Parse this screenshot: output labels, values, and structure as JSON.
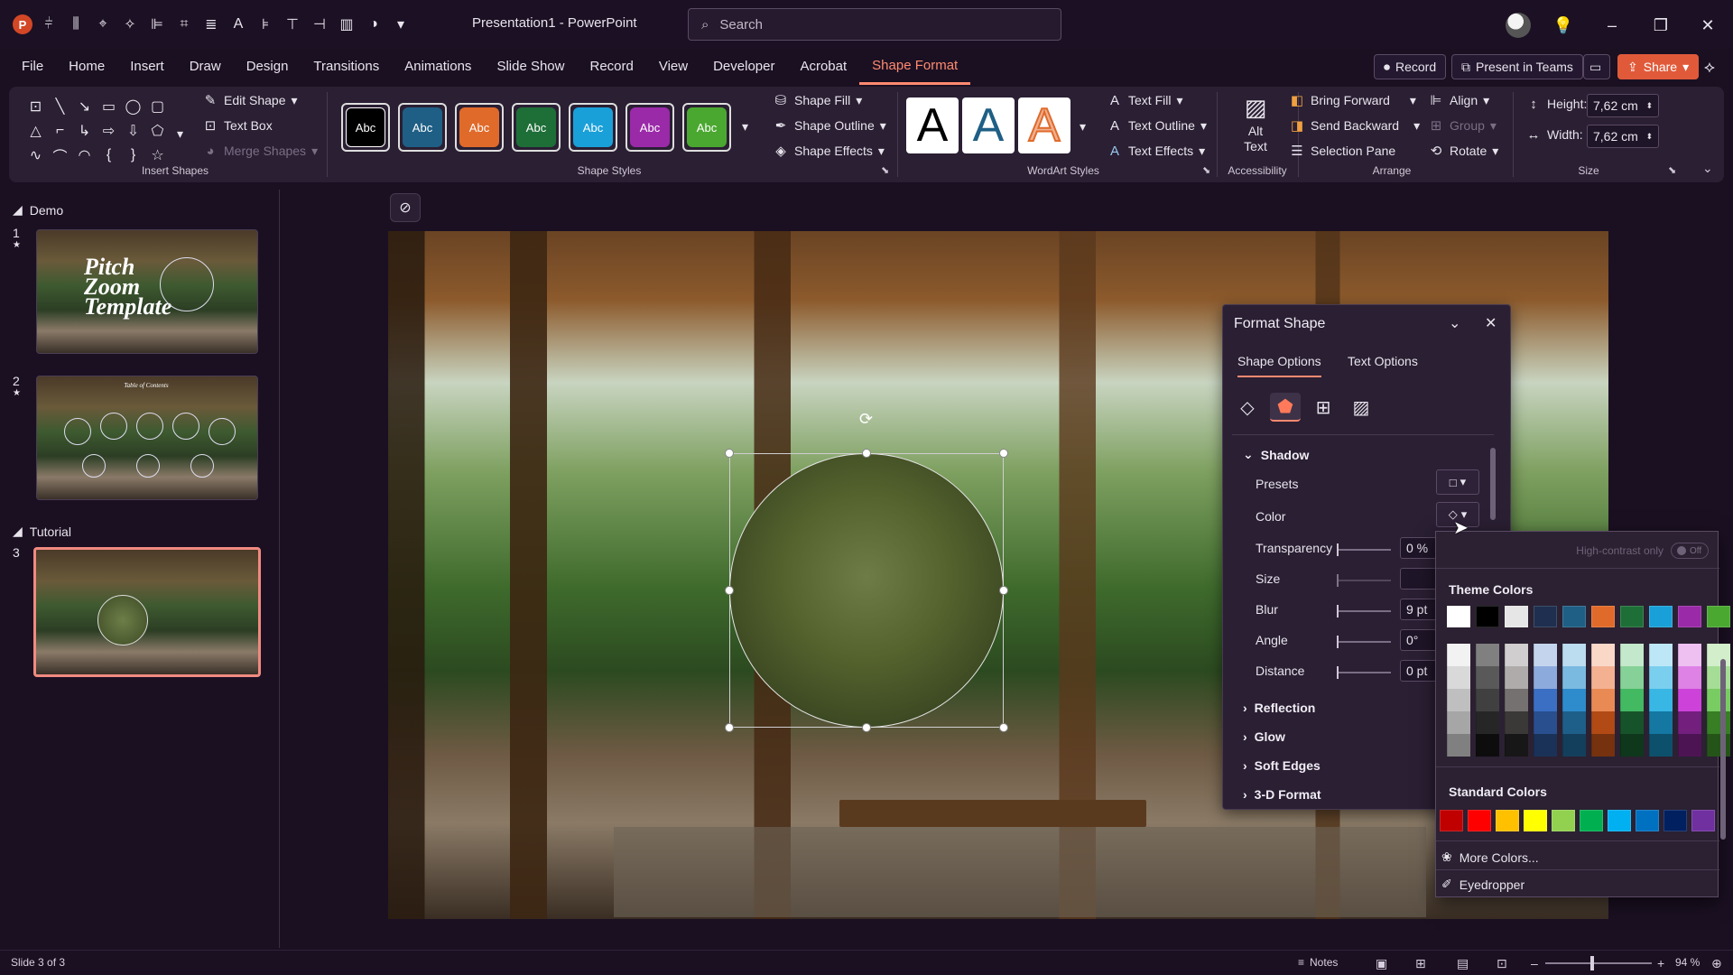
{
  "app": {
    "document_title": "Presentation1 - PowerPoint",
    "search_placeholder": "Search"
  },
  "ribbon_tabs": [
    {
      "label": "File"
    },
    {
      "label": "Home"
    },
    {
      "label": "Insert"
    },
    {
      "label": "Draw"
    },
    {
      "label": "Design"
    },
    {
      "label": "Transitions"
    },
    {
      "label": "Animations"
    },
    {
      "label": "Slide Show"
    },
    {
      "label": "Record"
    },
    {
      "label": "View"
    },
    {
      "label": "Developer"
    },
    {
      "label": "Acrobat"
    },
    {
      "label": "Shape Format",
      "active": true
    }
  ],
  "ribbon_actions": {
    "record": "Record",
    "present_in_teams": "Present in Teams",
    "share": "Share"
  },
  "ribbon": {
    "insert_shapes": {
      "label": "Insert Shapes",
      "edit_shape": "Edit Shape",
      "text_box": "Text Box",
      "merge_shapes": "Merge Shapes"
    },
    "shape_styles": {
      "label": "Shape Styles",
      "swatch_text": "Abc",
      "swatches": [
        {
          "fill": "#000000"
        },
        {
          "fill": "#1f5f85"
        },
        {
          "fill": "#e06a2a"
        },
        {
          "fill": "#1e6e38"
        },
        {
          "fill": "#1aa0d8"
        },
        {
          "fill": "#9a2aa8"
        },
        {
          "fill": "#4aa830"
        }
      ],
      "shape_fill": "Shape Fill",
      "shape_outline": "Shape Outline",
      "shape_effects": "Shape Effects"
    },
    "wordart_styles": {
      "label": "WordArt Styles",
      "letter": "A",
      "text_fill": "Text Fill",
      "text_outline": "Text Outline",
      "text_effects": "Text Effects"
    },
    "accessibility": {
      "label": "Accessibility",
      "alt_text": "Alt Text"
    },
    "arrange": {
      "label": "Arrange",
      "bring_forward": "Bring Forward",
      "send_backward": "Send Backward",
      "selection_pane": "Selection Pane",
      "align": "Align",
      "group": "Group",
      "rotate": "Rotate"
    },
    "size": {
      "label": "Size",
      "height_label": "Height:",
      "height_value": "7,62 cm",
      "width_label": "Width:",
      "width_value": "7,62 cm"
    }
  },
  "slides_panel": {
    "sections": [
      {
        "name": "Demo"
      },
      {
        "name": "Tutorial"
      }
    ],
    "slides": [
      {
        "number": "1",
        "thumb_text": "Pitch Zoom Template"
      },
      {
        "number": "2",
        "thumb_text": "Table of Contents"
      },
      {
        "number": "3",
        "selected": true
      }
    ]
  },
  "format_pane": {
    "title": "Format Shape",
    "tabs": [
      "Shape Options",
      "Text Options"
    ],
    "shadow": {
      "heading": "Shadow",
      "presets": "Presets",
      "color": "Color",
      "transparency": {
        "label": "Transparency",
        "value": "0 %"
      },
      "size": {
        "label": "Size",
        "value": ""
      },
      "blur": {
        "label": "Blur",
        "value": "9 pt"
      },
      "angle": {
        "label": "Angle",
        "value": "0°"
      },
      "distance": {
        "label": "Distance",
        "value": "0 pt"
      }
    },
    "collapsed_sections": [
      "Reflection",
      "Glow",
      "Soft Edges",
      "3-D Format"
    ]
  },
  "color_picker": {
    "high_contrast_label": "High-contrast only",
    "high_contrast_toggle": "Off",
    "theme_colors_heading": "Theme Colors",
    "theme_colors": [
      "#ffffff",
      "#000000",
      "#e7e6e6",
      "#1e2f4f",
      "#1f5f85",
      "#e06a2a",
      "#1e6e38",
      "#1aa0d8",
      "#9a2aa8",
      "#4aa830"
    ],
    "tint_columns": [
      [
        "#f2f2f2",
        "#d9d9d9",
        "#bfbfbf",
        "#a6a6a6",
        "#808080"
      ],
      [
        "#808080",
        "#595959",
        "#404040",
        "#262626",
        "#0d0d0d"
      ],
      [
        "#d0cece",
        "#afabab",
        "#767171",
        "#3b3838",
        "#181717"
      ],
      [
        "#c5d4ed",
        "#8daadc",
        "#3b6fc4",
        "#2a4f8e",
        "#1a3258"
      ],
      [
        "#bcdcf0",
        "#7abae0",
        "#2e8ccc",
        "#1e5f8a",
        "#143f5c"
      ],
      [
        "#f9d8c8",
        "#f3b192",
        "#e98a54",
        "#b14a15",
        "#76310e"
      ],
      [
        "#c3e8cb",
        "#86d197",
        "#43b962",
        "#17532a",
        "#0e371c"
      ],
      [
        "#bde7f6",
        "#7bcfee",
        "#38b7e5",
        "#1478a2",
        "#0d506c"
      ],
      [
        "#eec0f2",
        "#de82e6",
        "#cd43d9",
        "#731f7e",
        "#4d1454"
      ],
      [
        "#d2eecb",
        "#a5dd96",
        "#78cc62",
        "#377e24",
        "#255418"
      ]
    ],
    "standard_colors_heading": "Standard Colors",
    "standard_colors": [
      "#c00000",
      "#ff0000",
      "#ffc000",
      "#ffff00",
      "#92d050",
      "#00b050",
      "#00b0f0",
      "#0070c0",
      "#002060",
      "#7030a0"
    ],
    "more_colors": "More Colors...",
    "eyedropper": "Eyedropper"
  },
  "status_bar": {
    "slide_info": "Slide 3 of 3",
    "notes": "Notes",
    "zoom": "94 %"
  }
}
